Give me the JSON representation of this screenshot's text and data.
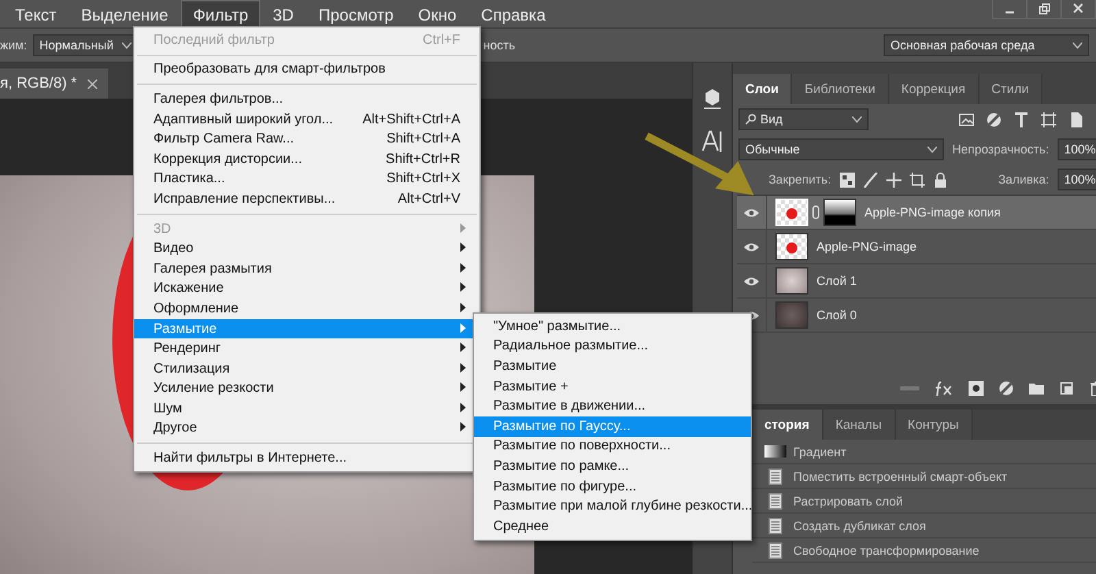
{
  "menubar": {
    "items": [
      {
        "label": "Текст",
        "selected": false
      },
      {
        "label": "Выделение",
        "selected": false
      },
      {
        "label": "Фильтр",
        "selected": true
      },
      {
        "label": "3D",
        "selected": false
      },
      {
        "label": "Просмотр",
        "selected": false
      },
      {
        "label": "Окно",
        "selected": false
      },
      {
        "label": "Справка",
        "selected": false
      }
    ]
  },
  "options_bar": {
    "mode_label": "жим:",
    "mode_value": "Нормальный",
    "trailing_label": "ность",
    "workspace": "Основная рабочая среда"
  },
  "document_tab": {
    "title": "я, RGB/8) *"
  },
  "filter_menu": {
    "items": [
      {
        "kind": "item",
        "label": "Последний фильтр",
        "shortcut": "Ctrl+F",
        "disabled": true,
        "submenu": false,
        "selected": false
      },
      {
        "kind": "separator"
      },
      {
        "kind": "item",
        "label": "Преобразовать для смарт-фильтров",
        "disabled": false,
        "submenu": false,
        "selected": false
      },
      {
        "kind": "separator"
      },
      {
        "kind": "item",
        "label": "Галерея фильтров...",
        "disabled": false,
        "submenu": false,
        "selected": false
      },
      {
        "kind": "item",
        "label": "Адаптивный широкий угол...",
        "shortcut": "Alt+Shift+Ctrl+A",
        "disabled": false,
        "submenu": false,
        "selected": false
      },
      {
        "kind": "item",
        "label": "Фильтр Camera Raw...",
        "shortcut": "Shift+Ctrl+A",
        "disabled": false,
        "submenu": false,
        "selected": false
      },
      {
        "kind": "item",
        "label": "Коррекция дисторсии...",
        "shortcut": "Shift+Ctrl+R",
        "disabled": false,
        "submenu": false,
        "selected": false
      },
      {
        "kind": "item",
        "label": "Пластика...",
        "shortcut": "Shift+Ctrl+X",
        "disabled": false,
        "submenu": false,
        "selected": false
      },
      {
        "kind": "item",
        "label": "Исправление перспективы...",
        "shortcut": "Alt+Ctrl+V",
        "disabled": false,
        "submenu": false,
        "selected": false
      },
      {
        "kind": "separator"
      },
      {
        "kind": "item",
        "label": "3D",
        "disabled": true,
        "submenu": true,
        "selected": false
      },
      {
        "kind": "item",
        "label": "Видео",
        "disabled": false,
        "submenu": true,
        "selected": false
      },
      {
        "kind": "item",
        "label": "Галерея размытия",
        "disabled": false,
        "submenu": true,
        "selected": false
      },
      {
        "kind": "item",
        "label": "Искажение",
        "disabled": false,
        "submenu": true,
        "selected": false
      },
      {
        "kind": "item",
        "label": "Оформление",
        "disabled": false,
        "submenu": true,
        "selected": false
      },
      {
        "kind": "item",
        "label": "Размытие",
        "disabled": false,
        "submenu": true,
        "selected": true
      },
      {
        "kind": "item",
        "label": "Рендеринг",
        "disabled": false,
        "submenu": true,
        "selected": false
      },
      {
        "kind": "item",
        "label": "Стилизация",
        "disabled": false,
        "submenu": true,
        "selected": false
      },
      {
        "kind": "item",
        "label": "Усиление резкости",
        "disabled": false,
        "submenu": true,
        "selected": false
      },
      {
        "kind": "item",
        "label": "Шум",
        "disabled": false,
        "submenu": true,
        "selected": false
      },
      {
        "kind": "item",
        "label": "Другое",
        "disabled": false,
        "submenu": true,
        "selected": false
      },
      {
        "kind": "separator"
      },
      {
        "kind": "item",
        "label": "Найти фильтры в Интернете...",
        "disabled": false,
        "submenu": false,
        "selected": false
      }
    ]
  },
  "blur_submenu": {
    "items": [
      {
        "label": "\"Умное\" размытие...",
        "selected": false
      },
      {
        "label": "Радиальное размытие...",
        "selected": false
      },
      {
        "label": "Размытие",
        "selected": false
      },
      {
        "label": "Размытие +",
        "selected": false
      },
      {
        "label": "Размытие в движении...",
        "selected": false
      },
      {
        "label": "Размытие по Гауссу...",
        "selected": true
      },
      {
        "label": "Размытие по поверхности...",
        "selected": false
      },
      {
        "label": "Размытие по рамке...",
        "selected": false
      },
      {
        "label": "Размытие по фигуре...",
        "selected": false
      },
      {
        "label": "Размытие при малой глубине резкости...",
        "selected": false
      },
      {
        "label": "Среднее",
        "selected": false
      }
    ]
  },
  "layers_panel": {
    "tabs": [
      {
        "label": "Слои",
        "selected": true
      },
      {
        "label": "Библиотеки",
        "selected": false
      },
      {
        "label": "Коррекция",
        "selected": false
      },
      {
        "label": "Стили",
        "selected": false
      }
    ],
    "filter": "Вид",
    "blend_mode": "Обычные",
    "opacity_label": "Непрозрачность:",
    "opacity": "100%",
    "lock_label": "Закрепить:",
    "fill_label": "Заливка:",
    "fill": "100%",
    "layers": [
      {
        "name": "Apple-PNG-image копия",
        "visible": true,
        "selected": true,
        "kind": "apple",
        "mask": true
      },
      {
        "name": "Apple-PNG-image",
        "visible": true,
        "selected": false,
        "kind": "apple",
        "mask": false
      },
      {
        "name": "Слой 1",
        "visible": true,
        "selected": false,
        "kind": "light",
        "mask": false
      },
      {
        "name": "Слой 0",
        "visible": true,
        "selected": false,
        "kind": "dark",
        "mask": false
      }
    ]
  },
  "history_panel": {
    "tabs": [
      {
        "label": "стория",
        "selected": true
      },
      {
        "label": "Каналы",
        "selected": false
      },
      {
        "label": "Контуры",
        "selected": false
      }
    ],
    "items": [
      {
        "label": "Градиент",
        "kind": "gradient"
      },
      {
        "label": "Поместить встроенный смарт-объект",
        "kind": "document"
      },
      {
        "label": "Растрировать слой",
        "kind": "document"
      },
      {
        "label": "Создать дубликат слоя",
        "kind": "document"
      },
      {
        "label": "Свободное трансформирование",
        "kind": "document"
      }
    ]
  }
}
